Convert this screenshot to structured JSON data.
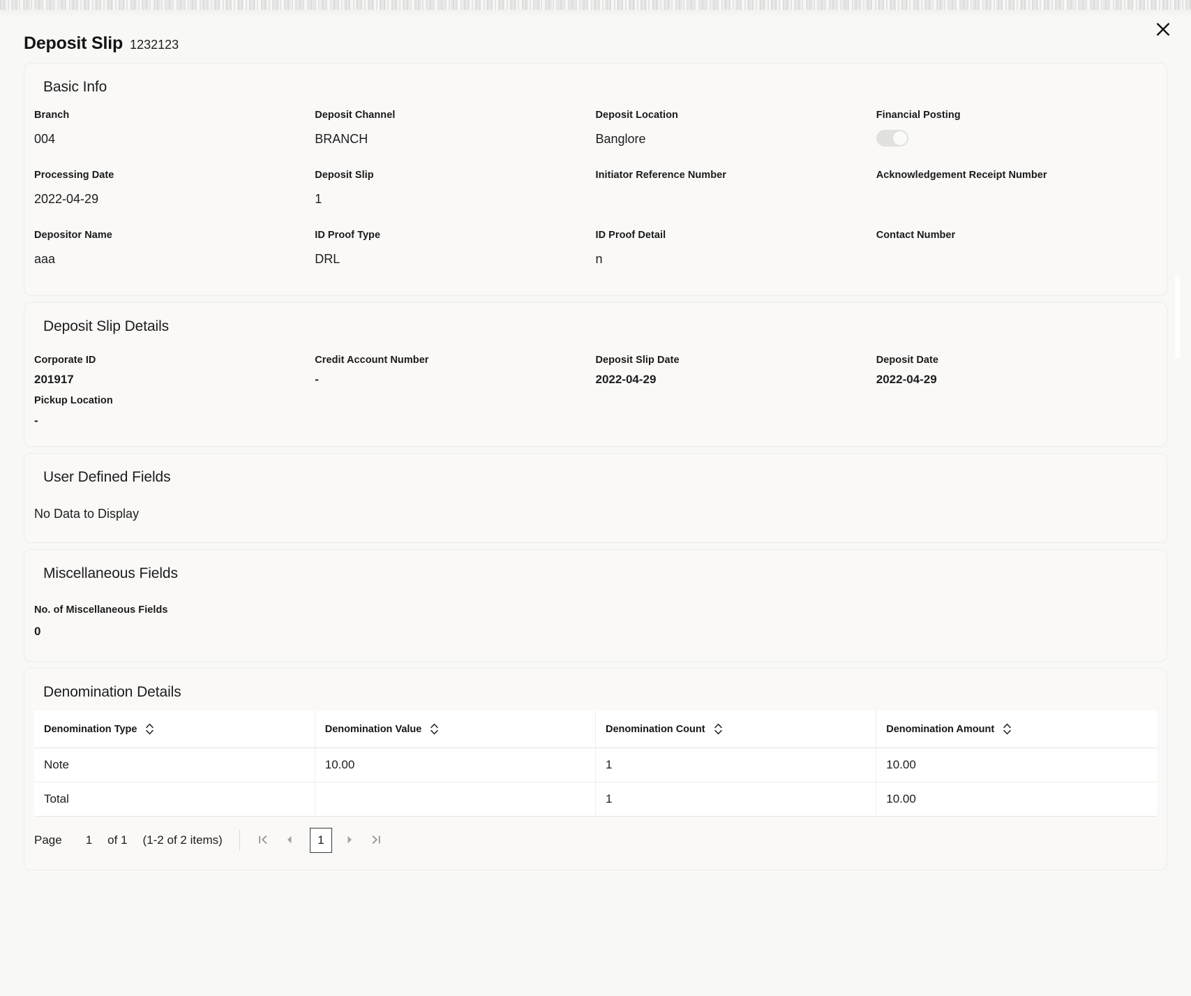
{
  "header": {
    "title": "Deposit Slip",
    "reference": "1232123",
    "close_icon": "close-icon"
  },
  "sections": {
    "basic_info": {
      "title": "Basic Info",
      "fields": [
        {
          "label": "Branch",
          "value": "004"
        },
        {
          "label": "Deposit Channel",
          "value": "BRANCH"
        },
        {
          "label": "Deposit Location",
          "value": "Banglore"
        },
        {
          "label": "Financial Posting",
          "value": "",
          "type": "toggle",
          "toggle_state": "off"
        },
        {
          "label": "Processing Date",
          "value": "2022-04-29"
        },
        {
          "label": "Deposit Slip",
          "value": "1"
        },
        {
          "label": "Initiator Reference Number",
          "value": ""
        },
        {
          "label": "Acknowledgement Receipt Number",
          "value": ""
        },
        {
          "label": "Depositor Name",
          "value": "aaa"
        },
        {
          "label": "ID Proof Type",
          "value": "DRL"
        },
        {
          "label": "ID Proof Detail",
          "value": "n"
        },
        {
          "label": "Contact Number",
          "value": ""
        }
      ]
    },
    "deposit_slip_details": {
      "title": "Deposit Slip Details",
      "fields": [
        {
          "label": "Corporate ID",
          "value": "201917"
        },
        {
          "label": "Credit Account Number",
          "value": "-"
        },
        {
          "label": "Deposit Slip Date",
          "value": "2022-04-29"
        },
        {
          "label": "Deposit Date",
          "value": "2022-04-29"
        },
        {
          "label": "Pickup Location",
          "value": "-"
        }
      ]
    },
    "user_defined_fields": {
      "title": "User Defined Fields",
      "empty_text": "No Data to Display"
    },
    "miscellaneous_fields": {
      "title": "Miscellaneous Fields",
      "count_label": "No. of Miscellaneous Fields",
      "count_value": "0"
    },
    "denomination_details": {
      "title": "Denomination Details",
      "columns": [
        "Denomination Type",
        "Denomination Value",
        "Denomination Count",
        "Denomination Amount"
      ],
      "rows": [
        [
          "Note",
          "10.00",
          "1",
          "10.00"
        ],
        [
          "Total",
          "",
          "1",
          "10.00"
        ]
      ],
      "pagination": {
        "page_label": "Page",
        "page_number": "1",
        "of_text": "of 1",
        "items_text": "(1-2 of 2 items)",
        "current_page": "1",
        "first_icon": "first-page-icon",
        "prev_icon": "previous-page-icon",
        "next_icon": "next-page-icon",
        "last_icon": "last-page-icon"
      }
    }
  },
  "colors": {
    "page_bg": "#f8f8f6",
    "card_bg": "#faf9f8",
    "card_border": "#ececea",
    "table_bg": "#ffffff",
    "text": "#1c1c1c",
    "toggle_track": "#e1e1df"
  }
}
